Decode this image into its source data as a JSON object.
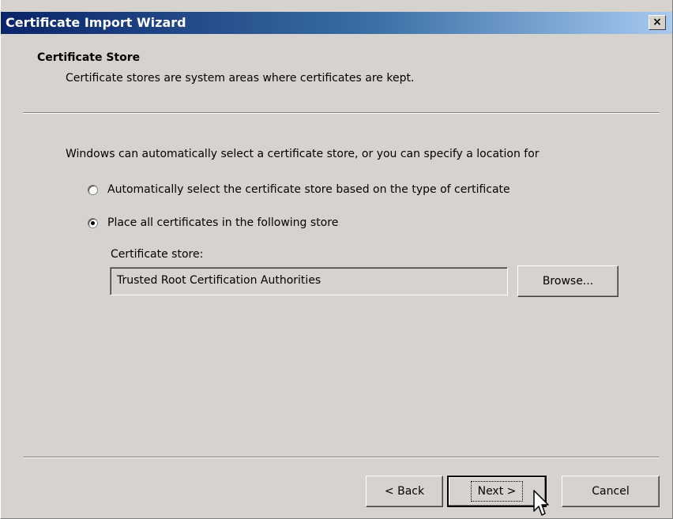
{
  "window": {
    "title": "Certificate Import Wizard",
    "close_glyph": "×"
  },
  "header": {
    "title": "Certificate Store",
    "subtitle": "Certificate stores are system areas where certificates are kept."
  },
  "body": {
    "intro": "Windows can automatically select a certificate store, or you can specify a location for",
    "options": [
      {
        "label": "Automatically select the certificate store based on the type of certificate",
        "checked": false
      },
      {
        "label": "Place all certificates in the following store",
        "checked": true
      }
    ],
    "store_label": "Certificate store:",
    "store_value": "Trusted Root Certification Authorities",
    "browse_label": "Browse..."
  },
  "footer": {
    "back_label": "< Back",
    "next_label": "Next >",
    "cancel_label": "Cancel"
  },
  "icons": {
    "cursor": "mouse-pointer-icon"
  }
}
